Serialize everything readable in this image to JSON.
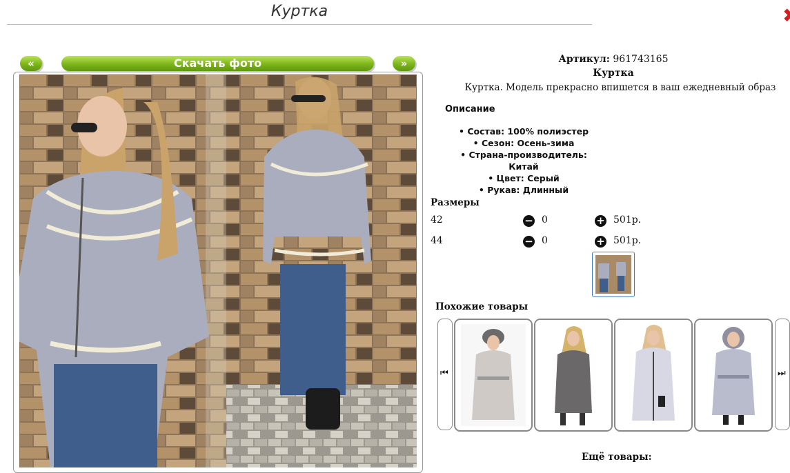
{
  "header": {
    "title": "Куртка"
  },
  "gallery": {
    "prev_label": "«",
    "download_label": "Скачать фото",
    "next_label": "»"
  },
  "product": {
    "sku_label": "Артикул:",
    "sku": "961743165",
    "name": "Куртка",
    "description": "Куртка. Модель прекрасно впишется в ваш ежедневный образ",
    "description_heading": "Описание",
    "specs": [
      "Состав: 100% полиэстер",
      "Сезон: Осень-зима",
      "Страна-производитель: Китай",
      "Цвет: Серый",
      "Рукав: Длинный"
    ]
  },
  "sizes": {
    "heading": "Размеры",
    "rows": [
      {
        "size": "42",
        "qty": "0",
        "price": "501р."
      },
      {
        "size": "44",
        "qty": "0",
        "price": "501р."
      }
    ]
  },
  "similar": {
    "heading": "Похожие товары",
    "left_arrow": "⏮",
    "right_arrow": "⏭"
  },
  "more": {
    "heading": "Ещё товары:"
  },
  "colors": {
    "accent_green": "#7db51a",
    "close_red": "#d21f1f",
    "jacket_grey": "#a9adbd"
  }
}
